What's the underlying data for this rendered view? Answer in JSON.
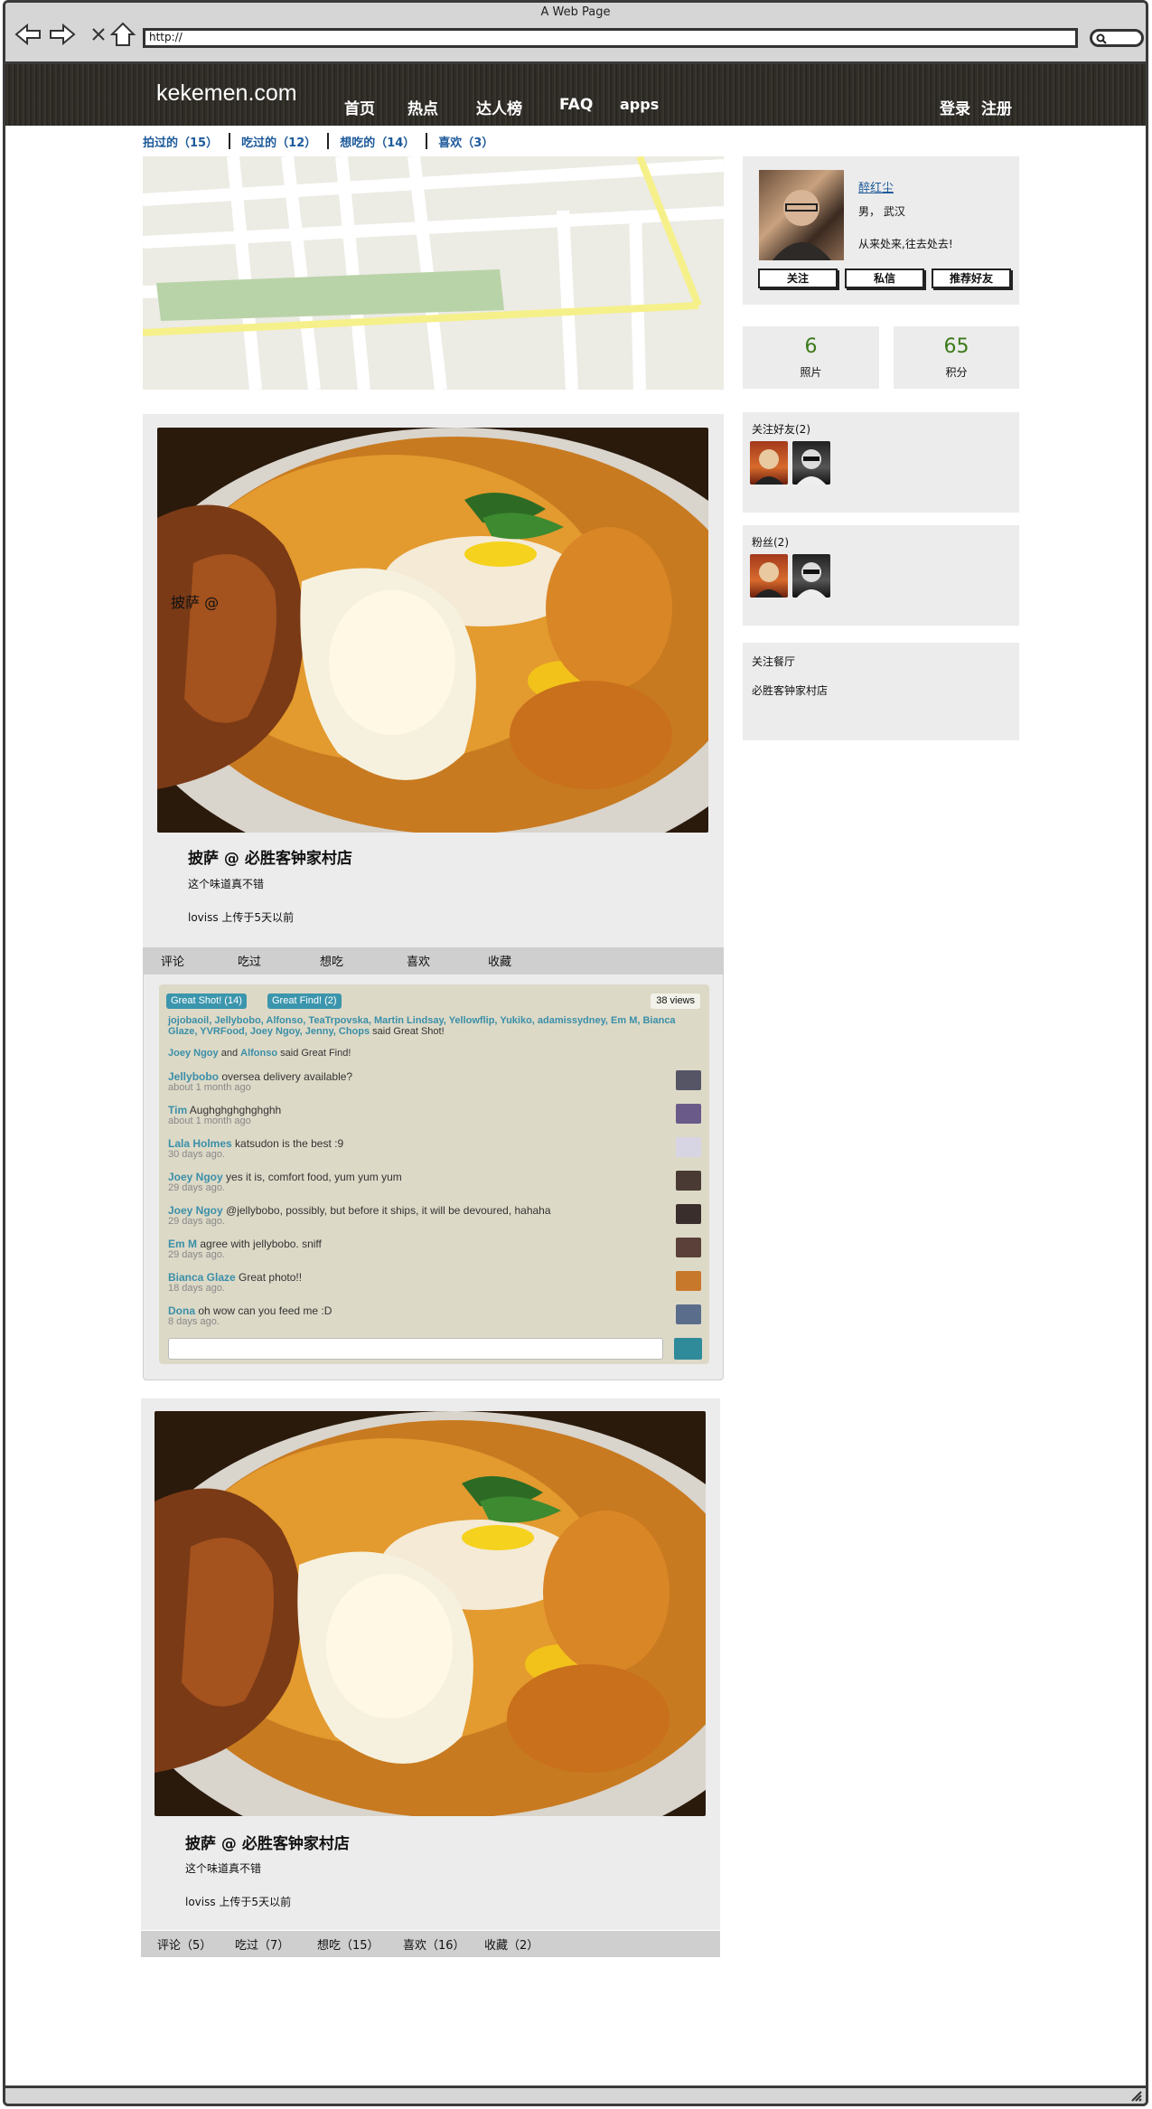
{
  "browser": {
    "window_title": "A Web Page",
    "url": "http://"
  },
  "site": {
    "logo": "kekemen.com",
    "nav": [
      "首页",
      "热点",
      "达人榜",
      "FAQ",
      "apps"
    ],
    "login": "登录",
    "register": "注册"
  },
  "subtabs": [
    "拍过的（15）",
    "吃过的（12）",
    "想吃的（14）",
    "喜欢（3）"
  ],
  "profile": {
    "name": "醉红尘",
    "info": "男，  武汉",
    "motto": "从来处来,往去处去!",
    "buttons": [
      "关注",
      "私信",
      "推荐好友"
    ]
  },
  "stats": [
    {
      "value": "6",
      "label": "照片"
    },
    {
      "value": "65",
      "label": "积分"
    }
  ],
  "following": {
    "title": "关注好友(2)"
  },
  "fans": {
    "title": "粉丝(2)"
  },
  "restaurants": {
    "title": "关注餐厅",
    "item": "必胜客钟家村店"
  },
  "posts": [
    {
      "overlay": "披萨 @",
      "title": "披萨  @  必胜客钟家村店",
      "desc": "这个味道真不错",
      "meta": "loviss 上传于5天以前",
      "actions": [
        "评论",
        "吃过",
        "想吃",
        "喜欢",
        "收藏"
      ]
    },
    {
      "title": "披萨  @  必胜客钟家村店",
      "desc": "这个味道真不错",
      "meta": "loviss 上传于5天以前",
      "actions": [
        "评论（5）",
        "吃过（7）",
        "想吃（15）",
        "喜欢（16）",
        "收藏（2）"
      ]
    }
  ],
  "comments": {
    "badge_shot": "Great Shot! (14)",
    "badge_find": "Great Find! (2)",
    "views": "38 views",
    "shot_users": "jojobaoil, Jellybobo, Alfonso, TeaTrpovska, Martin Lindsay, Yellowflip, Yukiko, adamissydney, Em M, Bianca Glaze, YVRFood, Joey Ngoy, Jenny, Chops",
    "shot_suffix": "said Great Shot!",
    "find_user1": "Joey Ngoy",
    "find_and": "and",
    "find_user2": "Alfonso",
    "find_suffix": "said Great Find!",
    "items": [
      {
        "user": "Jellybobo",
        "text": "oversea delivery available?",
        "when": "about 1 month ago"
      },
      {
        "user": "Tim",
        "text": "Aughghghghghghh",
        "when": "about 1 month ago"
      },
      {
        "user": "Lala Holmes",
        "text": "katsudon is the best :9",
        "when": "30 days ago."
      },
      {
        "user": "Joey Ngoy",
        "text": "yes it is, comfort food, yum yum yum",
        "when": "29 days ago."
      },
      {
        "user": "Joey Ngoy",
        "text": "@jellybobo, possibly, but before it ships, it will be devoured, hahaha",
        "when": "29 days ago."
      },
      {
        "user": "Em M",
        "text": "agree with jellybobo. sniff",
        "when": "29 days ago."
      },
      {
        "user": "Bianca Glaze",
        "text": "Great photo!!",
        "when": "18 days ago."
      },
      {
        "user": "Dona",
        "text": "oh wow can you feed me :D",
        "when": "8 days ago."
      }
    ]
  }
}
